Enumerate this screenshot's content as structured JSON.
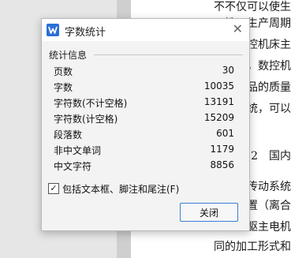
{
  "document": {
    "lines": [
      "不不仅可以使生",
      "性，生产周期",
      "控机床主",
      "，数控机",
      "品的质量",
      "统，可以",
      "2　国内",
      "传动系统",
      "置（离合",
      "驱主电机",
      "同的加工形式和"
    ]
  },
  "dialog": {
    "title": "字数统计",
    "section_title": "统计信息",
    "stats": [
      {
        "label": "页数",
        "value": "30"
      },
      {
        "label": "字数",
        "value": "10035"
      },
      {
        "label": "字符数(不计空格)",
        "value": "13191"
      },
      {
        "label": "字符数(计空格)",
        "value": "15209"
      },
      {
        "label": "段落数",
        "value": "601"
      },
      {
        "label": "非中文单词",
        "value": "1179"
      },
      {
        "label": "中文字符",
        "value": "8856"
      }
    ],
    "include_checkbox_label": "包括文本框、脚注和尾注(F)",
    "include_checked": "✓",
    "close_button_label": "关闭"
  }
}
